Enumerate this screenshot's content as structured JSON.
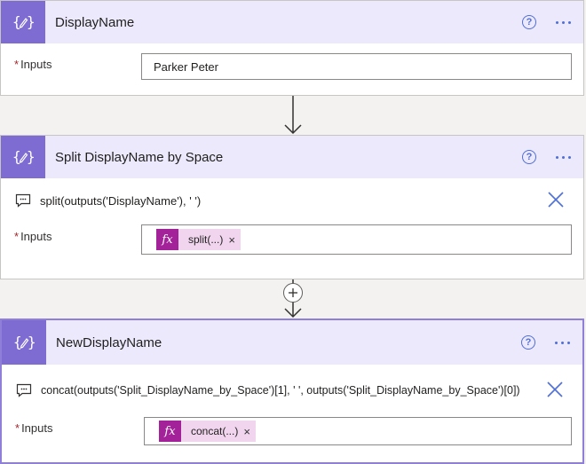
{
  "cards": [
    {
      "title": "DisplayName",
      "input_label": "Inputs",
      "input_value": "Parker Peter"
    },
    {
      "title": "Split DisplayName by Space",
      "expression": "split(outputs('DisplayName'), ' ')",
      "input_label": "Inputs",
      "token_icon": "fx",
      "token_label": "split(...)",
      "token_remove": "×"
    },
    {
      "title": "NewDisplayName",
      "expression": "concat(outputs('Split_DisplayName_by_Space')[1], ' ', outputs('Split_DisplayName_by_Space')[0])",
      "input_label": "Inputs",
      "token_icon": "fx",
      "token_label": "concat(...)",
      "token_remove": "×"
    }
  ],
  "help_glyph": "?",
  "required_marker": "*",
  "colors": {
    "header_bg": "#ede9fd",
    "icon_tile": "#7e6cd2",
    "accent_blue": "#4e6fd8",
    "token_fx": "#a3229a",
    "token_bg": "#f1d4ee",
    "required": "#a4262c"
  }
}
